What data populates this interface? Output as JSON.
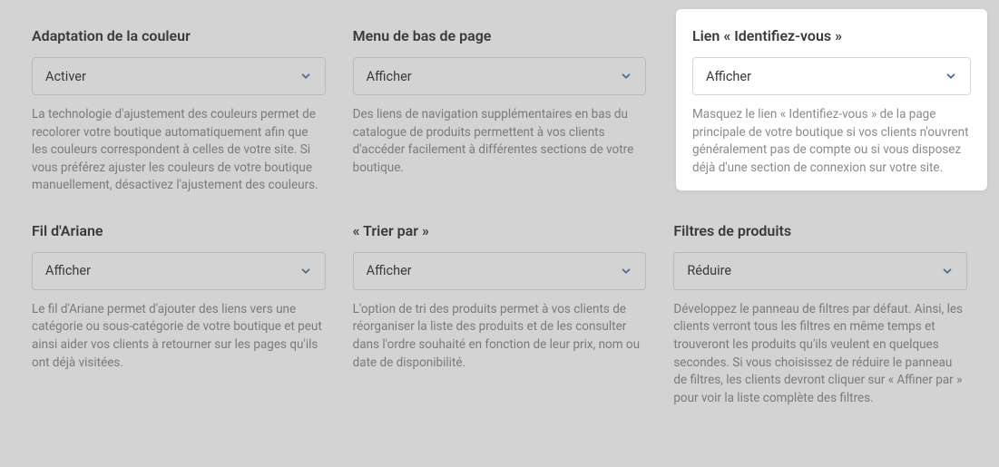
{
  "settings": {
    "colorAdaptation": {
      "title": "Adaptation de la couleur",
      "value": "Activer",
      "description": "La technologie d'ajustement des couleurs permet de recolorer votre boutique automatiquement afin que les couleurs correspondent à celles de votre site. Si vous préférez ajuster les couleurs de votre boutique manuellement, désactivez l'ajustement des couleurs."
    },
    "footerMenu": {
      "title": "Menu de bas de page",
      "value": "Afficher",
      "description": "Des liens de navigation supplémentaires en bas du catalogue de produits permettent à vos clients d'accéder facilement à différentes sections de votre boutique."
    },
    "signInLink": {
      "title": "Lien « Identifiez-vous »",
      "value": "Afficher",
      "description": "Masquez le lien « Identifiez-vous » de la page principale de votre boutique si vos clients n'ouvrent généralement pas de compte ou si vous disposez déjà d'une section de connexion sur votre site."
    },
    "breadcrumbs": {
      "title": "Fil d'Ariane",
      "value": "Afficher",
      "description": "Le fil d'Ariane permet d'ajouter des liens vers une catégorie ou sous-catégorie de votre boutique et peut ainsi aider vos clients à retourner sur les pages qu'ils ont déjà visitées."
    },
    "sortBy": {
      "title": "« Trier par »",
      "value": "Afficher",
      "description": "L'option de tri des produits permet à vos clients de réorganiser la liste des produits et de les consulter dans l'ordre souhaité en fonction de leur prix, nom ou date de disponibilité."
    },
    "productFilters": {
      "title": "Filtres de produits",
      "value": "Réduire",
      "description": "Développez le panneau de filtres par défaut. Ainsi, les clients verront tous les filtres en même temps et trouveront les produits qu'ils veulent en quelques secondes. Si vous choisissez de réduire le panneau de filtres, les clients devront cliquer sur « Affiner par » pour voir la liste complète des filtres."
    }
  }
}
